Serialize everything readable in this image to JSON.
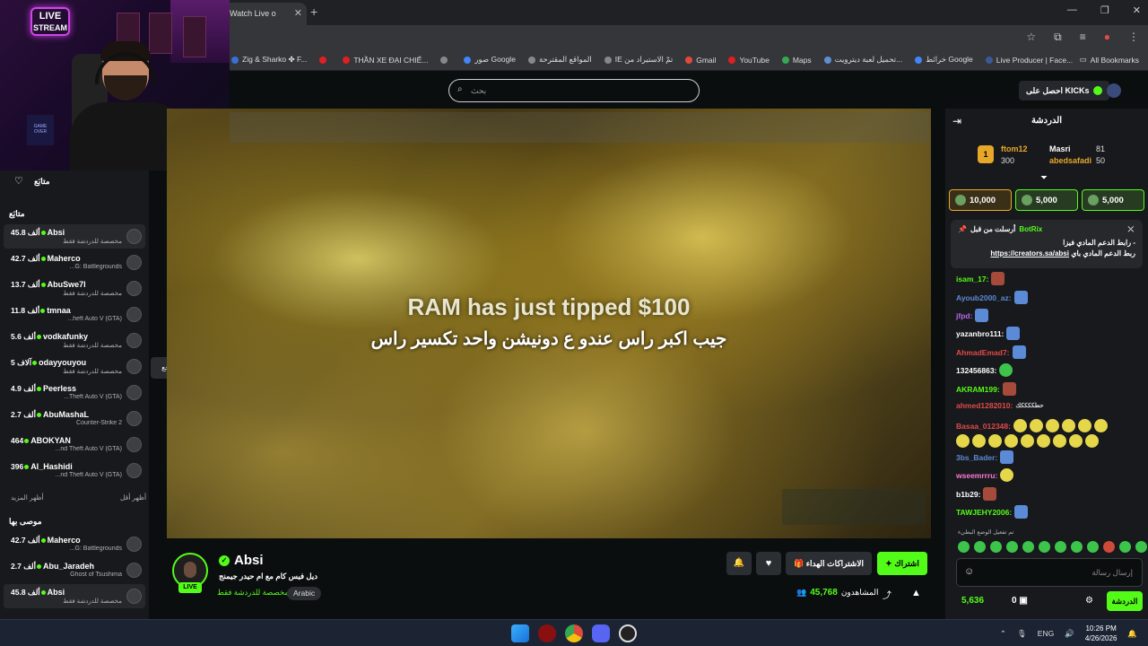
{
  "browser": {
    "tab_title": "Watch Live o",
    "bookmarks": [
      {
        "label": "Zig & Sharko ✤ F...",
        "color": "#3a6fd8"
      },
      {
        "label": "",
        "color": "#e02020"
      },
      {
        "label": "THẦN XE ĐẠI CHIẾ...",
        "color": "#e02020"
      },
      {
        "label": "",
        "color": "#888888"
      },
      {
        "label": "صور Google",
        "color": "#4285f4"
      },
      {
        "label": "المواقع المقترحة",
        "color": "#888888"
      },
      {
        "label": "IE تمّ الاستيراد من",
        "color": "#888888"
      },
      {
        "label": "Gmail",
        "color": "#e04a3a"
      },
      {
        "label": "YouTube",
        "color": "#e02020"
      },
      {
        "label": "Maps",
        "color": "#34a853"
      },
      {
        "label": "تحميل لعبة ديترويت...",
        "color": "#5f8fd0"
      },
      {
        "label": "خرائط Google",
        "color": "#4285f4"
      },
      {
        "label": "Live Producer | Face...",
        "color": "#3b5998"
      }
    ],
    "all_bookmarks": "All Bookmarks"
  },
  "header": {
    "search_placeholder": "بحث",
    "get_kicks": "احصل على KICKs"
  },
  "webcam": {
    "live_badge_line1": "LIVE",
    "live_badge_line2": "STREAM",
    "poster_text": "GAME OVER"
  },
  "sidebar": {
    "title": "متابَع",
    "following_header": "متابَع",
    "show_more": "أظهر المزيد",
    "show_less": "أظهر أقل",
    "recommended_header": "موصى بها",
    "following": [
      {
        "count": "45.8 ألف",
        "name": "Absi",
        "category": "مخصصة للدردشة فقط",
        "active": true
      },
      {
        "count": "42.7 ألف",
        "name": "Maherco",
        "category": "...G: Battlegrounds",
        "active": false
      },
      {
        "count": "13.7 ألف",
        "name": "AbuSwe7l",
        "category": "مخصصة للدردشة فقط",
        "active": false
      },
      {
        "count": "11.8 ألف",
        "name": "tmnaa",
        "category": "...heft Auto V (GTA)",
        "active": false
      },
      {
        "count": "5.6 ألف",
        "name": "vodkafunky",
        "category": "مخصصة للدردشة فقط",
        "active": false
      },
      {
        "count": "5 آلاف",
        "name": "odayyouyou",
        "category": "مخصصة للدردشة فقط",
        "active": false
      },
      {
        "count": "4.9 ألف",
        "name": "Peerless",
        "category": "...Theft Auto V (GTA)",
        "active": false
      },
      {
        "count": "2.7 ألف",
        "name": "AbuMashaL",
        "category": "Counter-Strike 2",
        "active": false
      },
      {
        "count": "464",
        "name": "ABOKYAN",
        "category": "...nd Theft Auto V (GTA)",
        "active": false
      },
      {
        "count": "396",
        "name": "Al_Hashidi",
        "category": "...nd Theft Auto V (GTA)",
        "active": false
      }
    ],
    "recommended": [
      {
        "count": "42.7 ألف",
        "name": "Maherco",
        "category": "...G: Battlegrounds",
        "active": false
      },
      {
        "count": "2.7 ألف",
        "name": "Abu_Jaradeh",
        "category": "Ghost of Tsushima",
        "active": false
      },
      {
        "count": "45.8 ألف",
        "name": "Absi",
        "category": "مخصصة للدردشة فقط",
        "active": true
      }
    ],
    "tooltip": "رجع رجع رجع"
  },
  "video": {
    "tip_message": "RAM has just tipped $100",
    "tip_text": "جيب اكبر راس عندو ع دونيشن واحد تكسير راس"
  },
  "channel": {
    "name": "Absi",
    "live": "LIVE",
    "title": "ديل فيس كام مع ام حيدر جيمنج",
    "category": "مخصصة للدردشة فقط",
    "language": "Arabic",
    "subscribe": "اشتراك",
    "gift_subs": "الاشتراكات الهداء",
    "viewers_label": "المشاهدون",
    "viewers": "45,768"
  },
  "chat": {
    "title": "الدردشة",
    "leaderboard": [
      {
        "name": "ftom12",
        "value": "300",
        "name_color": "#e7a82a"
      },
      {
        "name": "Masri",
        "value": "81",
        "name_color": "#ffffff"
      },
      {
        "name": "abedsafadi",
        "value": "50",
        "name_color": "#e7a82a"
      }
    ],
    "rank": "1",
    "gifts": [
      "10,000",
      "5,000",
      "5,000"
    ],
    "pinned": {
      "author": "BotRix",
      "sent_label": "أرسلت من قبل",
      "line1": "- رابط الدعم المادي فيزا",
      "link": "https://creators.sa/absi",
      "line2": "ربط الدعم المادي باي"
    },
    "messages": [
      {
        "user": "isam_17:",
        "color": "#53fc18",
        "text": "",
        "emotes": [
          "red"
        ]
      },
      {
        "user": "Ayoub2000_az:",
        "color": "#5b8ad6",
        "text": "",
        "emotes": [
          "blue"
        ]
      },
      {
        "user": "jfpd:",
        "color": "#b46ae8",
        "text": "",
        "emotes": [
          "blue"
        ]
      },
      {
        "user": "yazanbro111:",
        "color": "#ffffff",
        "text": "",
        "emotes": [
          "blue"
        ]
      },
      {
        "user": "AhmadEmad7:",
        "color": "#e04a4a",
        "text": "",
        "emotes": [
          "blue"
        ]
      },
      {
        "user": "132456863:",
        "color": "#ffffff",
        "text": "",
        "emotes": [
          "green"
        ]
      },
      {
        "user": "AKRAM199:",
        "color": "#53fc18",
        "text": "",
        "emotes": [
          "red"
        ]
      },
      {
        "user": "ahmed1282010:",
        "color": "#e04a4a",
        "text": "حطككككك",
        "emotes": []
      },
      {
        "user": "Basaa_012348:",
        "color": "#e04a4a",
        "text": "",
        "emotes": [
          "yellow",
          "yellow",
          "yellow",
          "yellow",
          "yellow",
          "yellow",
          "yellow",
          "yellow",
          "yellow",
          "yellow",
          "yellow",
          "yellow",
          "yellow",
          "yellow",
          "yellow"
        ]
      },
      {
        "user": "3bs_Bader:",
        "color": "#5b8ad6",
        "text": "",
        "emotes": [
          "blue"
        ]
      },
      {
        "user": "wseemrrru:",
        "color": "#ff7ad8",
        "text": "",
        "emotes": [
          "yellow"
        ]
      },
      {
        "user": "b1b29:",
        "color": "#ffffff",
        "text": "",
        "emotes": [
          "red"
        ]
      },
      {
        "user": "TAWJEHY2006:",
        "color": "#53fc18",
        "text": "",
        "emotes": [
          "blue"
        ]
      }
    ],
    "emote_mode_hint": "تم تفعيل الوضع البطيء",
    "input_placeholder": "إرسال رسالة",
    "send_button": "الدردشة",
    "kick_points": "5,636",
    "zero": "0"
  },
  "taskbar": {
    "lang": "ENG",
    "time": "10:26 PM",
    "date": "4/26/2026"
  }
}
